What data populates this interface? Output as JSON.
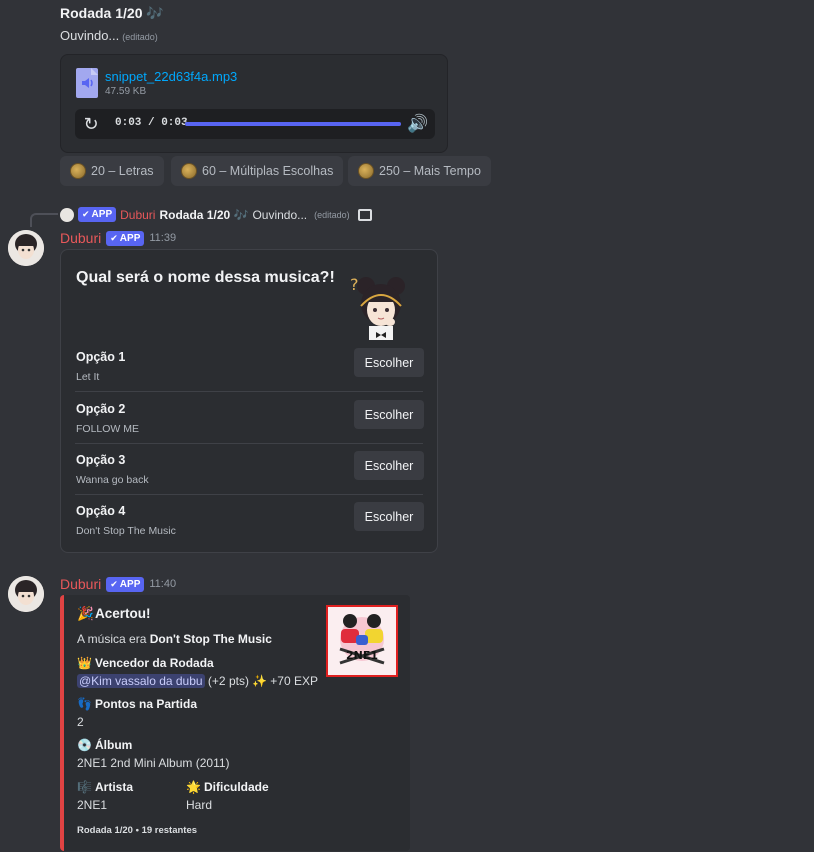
{
  "top_message": {
    "title": "Rodada 1/20 🎶",
    "subtitle": "Ouvindo...",
    "edited": "(editado)",
    "file": {
      "name": "snippet_22d63f4a.mp3",
      "size": "47.59 KB"
    },
    "player": {
      "time": "0:03 / 0:03",
      "progress": 1.0
    }
  },
  "buttons": [
    {
      "label": "20 – Letras"
    },
    {
      "label": "60 – Múltiplas Escolhas"
    },
    {
      "label": "250 – Mais Tempo"
    }
  ],
  "reply": {
    "badge": "APP",
    "author": "Duburi",
    "text_bold": "Rodada 1/20 🎶",
    "text": "Ouvindo...",
    "edited": "(editado)"
  },
  "message2": {
    "author": "Duburi",
    "badge": "APP",
    "time": "11:39",
    "question": "Qual será o nome dessa musica?!",
    "choose_label": "Escolher",
    "options": [
      {
        "label": "Opção 1",
        "value": "Let It"
      },
      {
        "label": "Opção 2",
        "value": "FOLLOW ME"
      },
      {
        "label": "Opção 3",
        "value": "Wanna go back"
      },
      {
        "label": "Opção 4",
        "value": "Don't Stop The Music"
      }
    ]
  },
  "message3": {
    "author": "Duburi",
    "badge": "APP",
    "time": "11:40",
    "title": "Acertou!",
    "answer_prefix": "A música era ",
    "answer": "Don't Stop The Music",
    "winner_label": "Vencedor da Rodada",
    "winner_mention": "@Kim vassalo da dubu",
    "winner_points": " (+2 pts) ",
    "winner_exp": "+70 EXP",
    "points_label": "Pontos na Partida",
    "points_value": "2",
    "album_label": "Álbum",
    "album_value": "2NE1 2nd Mini Album (2011)",
    "artist_label": "Artista",
    "artist_value": "2NE1",
    "difficulty_label": "Dificuldade",
    "difficulty_value": "Hard",
    "footer": "Rodada 1/20 • 19 restantes",
    "album_art_text": "2NE1"
  },
  "colors": {
    "accent": "#5865f2",
    "author": "#e8585a",
    "embed_border": "#e04343",
    "link": "#00a8fc"
  }
}
